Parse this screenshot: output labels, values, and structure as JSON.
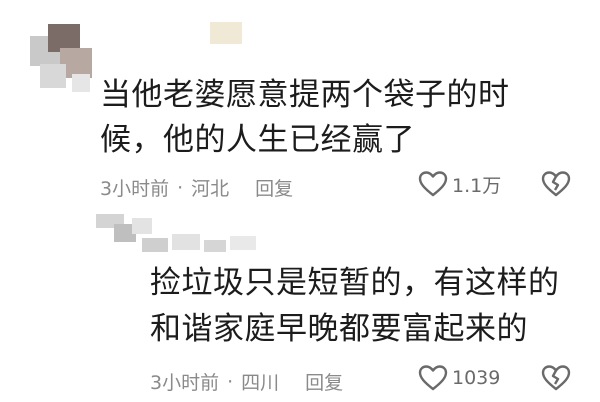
{
  "comments": [
    {
      "text_line1": "当他老婆愿意提两个袋子的时",
      "text_line2": "候，他的人生已经赢了",
      "time": "3小时前",
      "location": "河北",
      "reply_label": "回复",
      "likes": "1.1万"
    },
    {
      "text_line1": "捡垃圾只是短暂的，有这样的",
      "text_line2": "和谐家庭早晚都要富起来的",
      "time": "3小时前",
      "location": "四川",
      "reply_label": "回复",
      "likes": "1039"
    }
  ],
  "separator": "·",
  "icons": {
    "like": "heart-outline-icon",
    "dislike": "broken-heart-icon"
  },
  "colors": {
    "text": "#1c1c1c",
    "meta": "#8a8a8a",
    "icon": "#6a6a6a"
  }
}
